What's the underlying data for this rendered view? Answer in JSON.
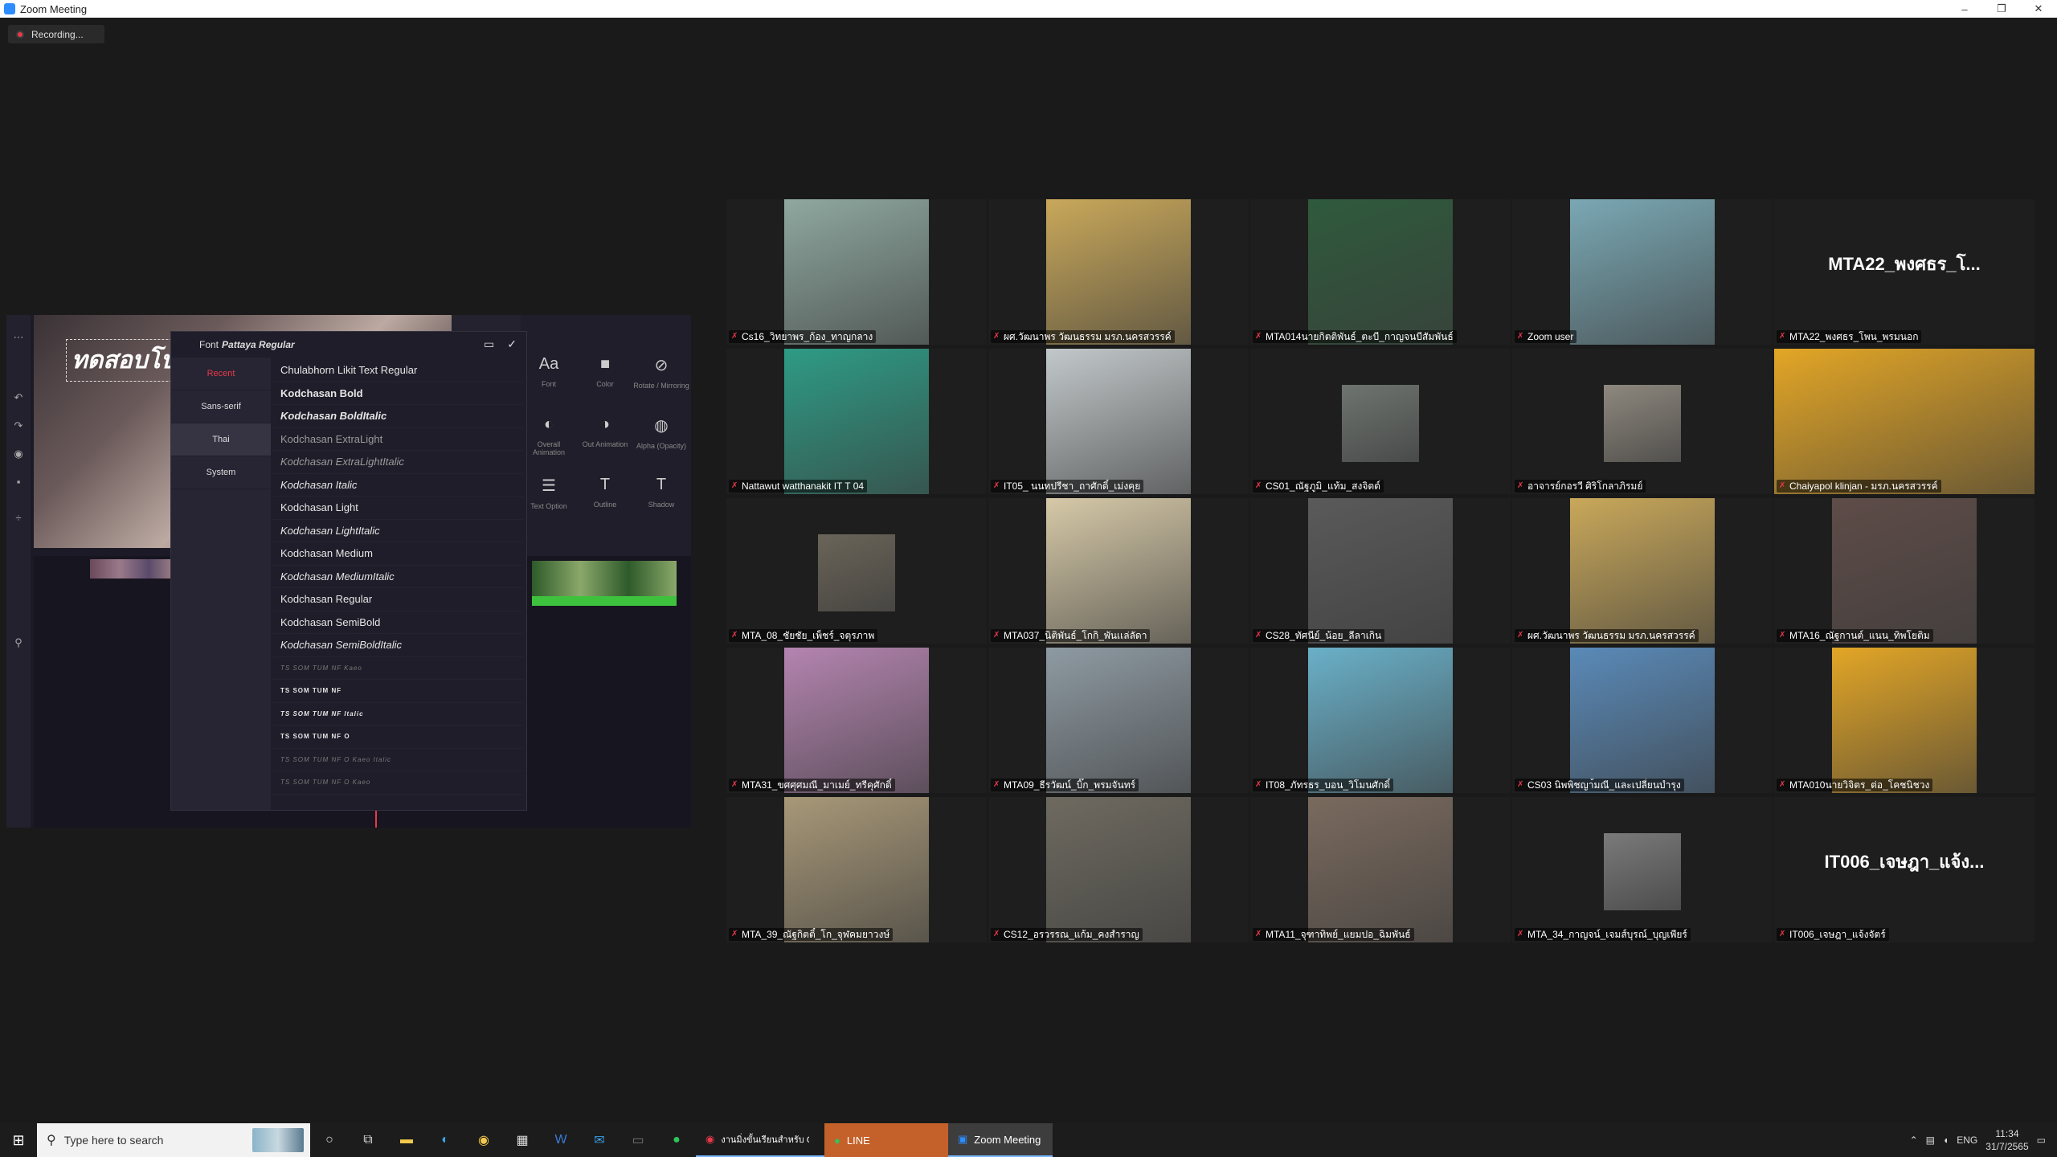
{
  "window": {
    "title": "Zoom Meeting",
    "minimize": "–",
    "restore": "❐",
    "close": "✕"
  },
  "recording": {
    "label": "Recording..."
  },
  "share": {
    "overlay_text": "ทดสอบโปรแก",
    "tools": [
      {
        "glyph": "Aa",
        "label": "Font"
      },
      {
        "glyph": "■",
        "label": "Color"
      },
      {
        "glyph": "⊘",
        "label": "Rotate / Mirroring"
      },
      {
        "glyph": "◐",
        "label": "Overall Animation"
      },
      {
        "glyph": "◑",
        "label": "Out Animation"
      },
      {
        "glyph": "◍",
        "label": "Alpha (Opacity)"
      },
      {
        "glyph": "☰",
        "label": "Text Option"
      },
      {
        "glyph": "T",
        "label": "Outline"
      },
      {
        "glyph": "T",
        "label": "Shadow"
      }
    ],
    "confirm": "✓"
  },
  "font_dialog": {
    "label": "Font",
    "selected": "Pattaya Regular",
    "save": "▭",
    "confirm": "✓",
    "categories": [
      "Recent",
      "Sans-serif",
      "Thai",
      "System"
    ],
    "fonts": [
      "Chulabhorn Likit Text Regular",
      "Kodchasan Bold",
      "Kodchasan BoldItalic",
      "Kodchasan ExtraLight",
      "Kodchasan ExtraLightItalic",
      "Kodchasan Italic",
      "Kodchasan Light",
      "Kodchasan LightItalic",
      "Kodchasan Medium",
      "Kodchasan MediumItalic",
      "Kodchasan Regular",
      "Kodchasan SemiBold",
      "Kodchasan SemiBoldItalic",
      "TS SOM TUM NF Kaeo",
      "TS SOM TUM NF",
      "TS SOM TUM NF Italic",
      "TS SOM TUM NF O",
      "TS SOM TUM NF O Kaeo Italic",
      "TS SOM TUM NF O Kaeo"
    ]
  },
  "participants": [
    {
      "name": "Cs16_วิทยาพร_ก้อง_ทาญกลาง",
      "color": "#8fa8a0"
    },
    {
      "name": "ผศ.วัฒนาพร วัฒนธรรม มรภ.นครสวรรค์",
      "color": "#c9a85a"
    },
    {
      "name": "MTA014นายกิตติพันธ์_ตะบี_กาญจนบีสัมพันธ์",
      "color": "#2f5a3c"
    },
    {
      "name": "Zoom user",
      "color": "#7aa8b4"
    },
    {
      "name": "MTA22_พงศธร_โพน_พรมนอก",
      "color": ""
    },
    {
      "name": "Nattawut watthanakit IT T 04",
      "color": "#2e9b85"
    },
    {
      "name": "IT05_ นนทปรีชา_ถาศักดิ์_เม่งคุย",
      "color": "#c2c8ca"
    },
    {
      "name": "CS01_ณัฐภูมิ_แท้ม_สงจิตต์",
      "color": "#6e7470"
    },
    {
      "name": "อาจารย์กอรวี ศิริโกลาภิรมย์",
      "color": "#8e887e"
    },
    {
      "name": "Chaiyapol klinjan - มรภ.นครสวรรค์",
      "color": "#e3a626"
    },
    {
      "name": "MTA_08_ชัยชัย_เพ็ชร์_จตุรภาพ",
      "color": "#6a6458"
    },
    {
      "name": "MTA037_นิติพันธ์_โกกิ_พันเเล่ลัดา",
      "color": "#d6c9a8"
    },
    {
      "name": "CS28_ทัศนีย์_น้อย_ลีลาเกิน",
      "color": "#5a5a5a"
    },
    {
      "name": "ผศ.วัฒนาพร วัฒนธรรม มรภ.นครสวรรค์",
      "color": "#c9a85a"
    },
    {
      "name": "MTA16_ณัฐกานต์_แนน_ทิพโยติม",
      "color": "#5e4c48"
    },
    {
      "name": "MTA31_ขศศุศมณี_มาเมย์_ทรีคุศักดิ์",
      "color": "#b484b0"
    },
    {
      "name": "MTA09_ธีรวัฒน์_บิ๊ก_พรมจันทร์",
      "color": "#8e9aa2"
    },
    {
      "name": "IT08_ภัทรธร_บอน_วิโมนศักดิ์",
      "color": "#6ab0c8"
    },
    {
      "name": "CS03 นิพพิชญา้มณี_และเปลี่ยนบำรุง",
      "color": "#5a8ab8"
    },
    {
      "name": "MTA010นายวิจิตร_ต่อ_โคชนิชวง",
      "color": "#e3a626"
    },
    {
      "name": "MTA_39_ณัฐกิตติ์_โก_จุฬคมยาวงษ์",
      "color": "#a89878"
    },
    {
      "name": "CS12_อรวรรณ_แก้ม_คงสำราญ",
      "color": "#6e6a60"
    },
    {
      "name": "MTA11_จุฑาทิพย์_แยมปอ_ฉิมพันธ์",
      "color": "#7a6a5e"
    },
    {
      "name": "MTA_34_กาญจน์_เจมส์บุรณ์_บุญเพียร์",
      "color": "#7a7a7a"
    },
    {
      "name": "IT006_เจษฎา_แจ้งจัตร์",
      "color": ""
    }
  ],
  "name_only_tiles": {
    "4": "MTA22_พงศธร_โ...",
    "24": "IT006_เจษฎา_แจ้ง..."
  },
  "taskbar": {
    "start_icon": "⊞",
    "search_placeholder": "Type here to search",
    "line_label": "LINE",
    "zoom_label": "Zoom Meeting",
    "chrome_label": "งานมิ่งขั้นเรียนสำหรับ C...",
    "lang": "ENG",
    "time": "11:34",
    "date": "31/7/2565"
  }
}
